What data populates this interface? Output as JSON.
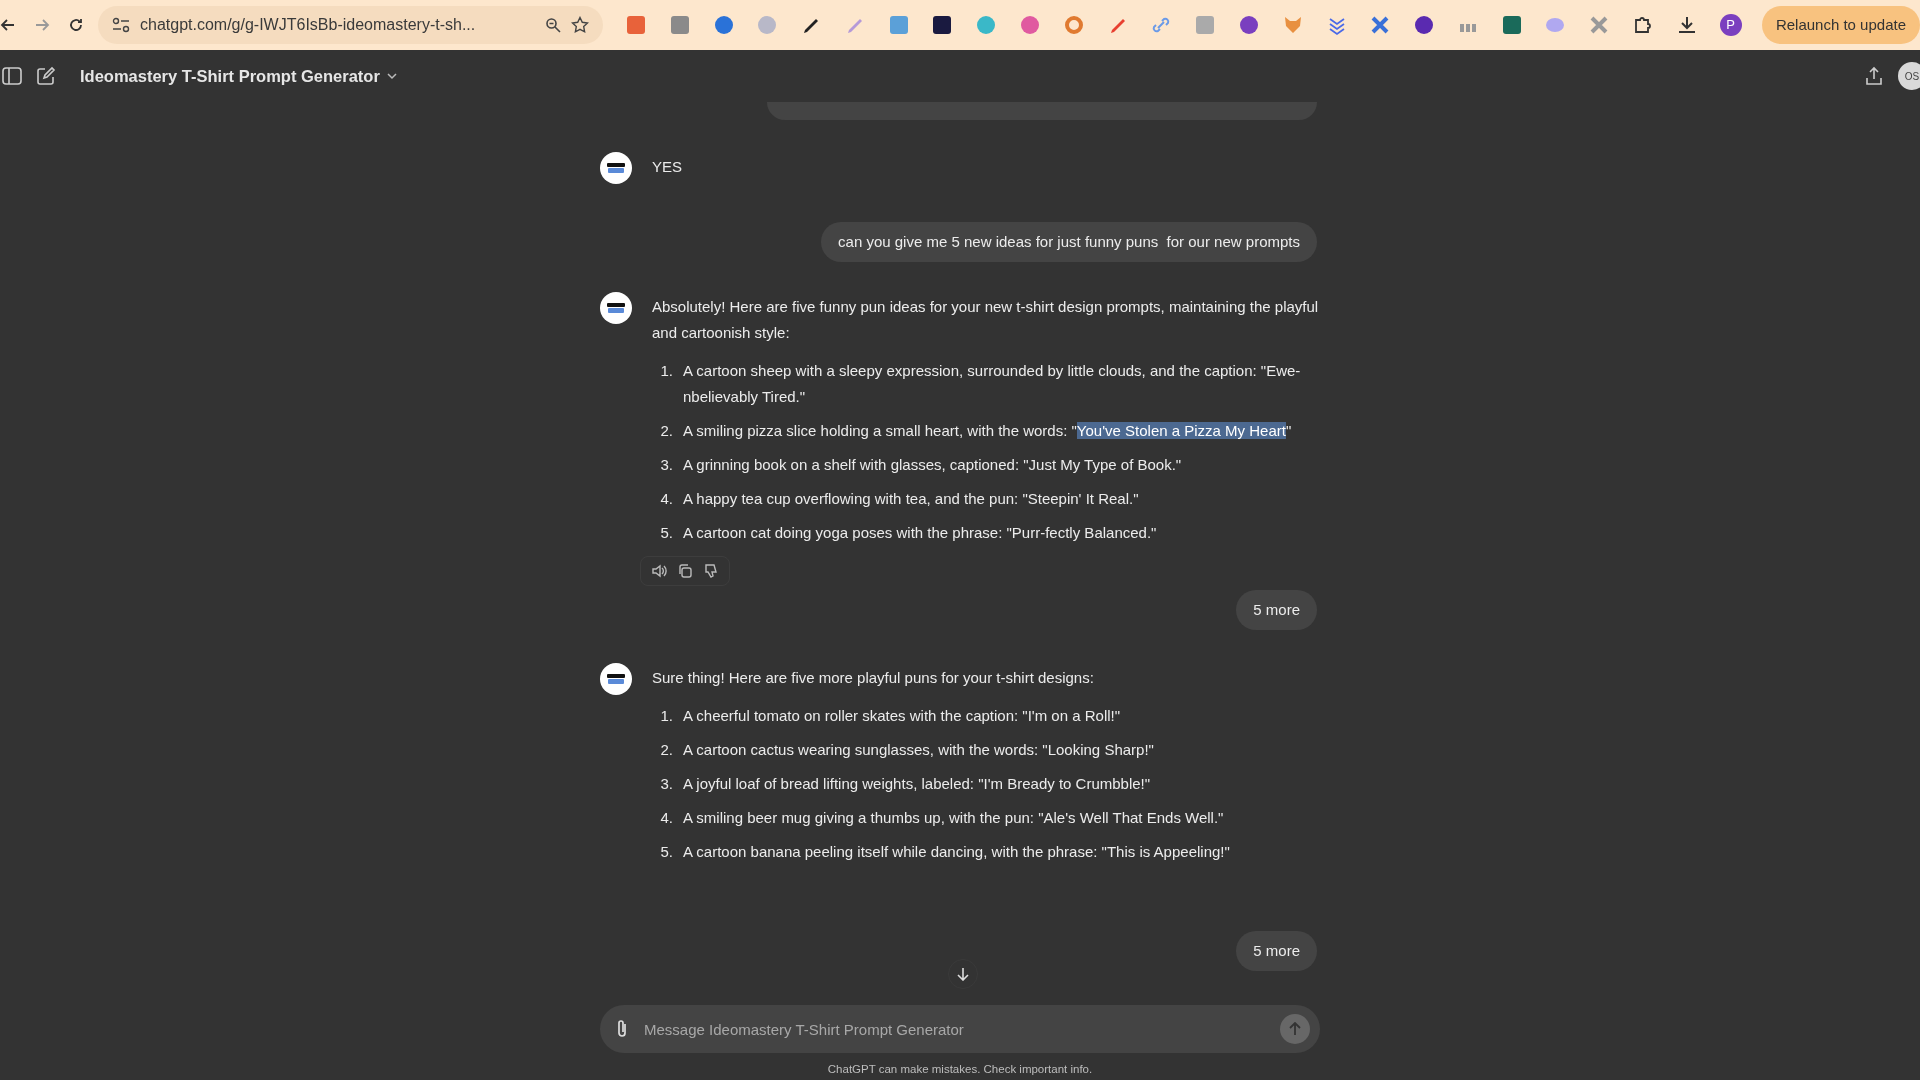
{
  "browser": {
    "url": "chatgpt.com/g/g-IWJT6IsBb-ideomastery-t-sh...",
    "profile_initial": "P",
    "relaunch_button": "Relaunch to update"
  },
  "header": {
    "title": "Ideomastery T-Shirt Prompt Generator",
    "user_initials": "OS"
  },
  "messages": [
    {
      "kind": "clipped"
    },
    {
      "kind": "assistant",
      "text": "YES",
      "show_actions": false
    },
    {
      "kind": "user",
      "text": "can you give me 5 new ideas for just funny puns  for our new prompts"
    },
    {
      "kind": "assistant",
      "text": "Absolutely! Here are five funny pun ideas for your new t-shirt design prompts, maintaining the playful and cartoonish style:",
      "show_actions": true,
      "items": [
        {
          "number": "1.",
          "text": "A cartoon sheep with a sleepy expression, surrounded by little clouds, and the caption: \"Ewe-nbelievably Tired.\""
        },
        {
          "number": "2.",
          "text": "A smiling pizza slice holding a small heart, with the words: \"",
          "selection": "You've Stolen a Pizza My Heart",
          "after": "\""
        },
        {
          "number": "3.",
          "text": "A grinning book on a shelf with glasses, captioned: \"Just My Type of Book.\""
        },
        {
          "number": "4.",
          "text": "A happy tea cup overflowing with tea, and the pun: \"Steepin' It Real.\""
        },
        {
          "number": "5.",
          "text": "A cartoon cat doing yoga poses with the phrase: \"Purr-fectly Balanced.\""
        }
      ]
    },
    {
      "kind": "user",
      "text": "5 more"
    },
    {
      "kind": "assistant",
      "text": "Sure thing! Here are five more playful puns for your t-shirt designs:",
      "show_actions": false,
      "items": [
        {
          "number": "1.",
          "text": "A cheerful tomato on roller skates with the caption: \"I'm on a Roll!\""
        },
        {
          "number": "2.",
          "text": "A cartoon cactus wearing sunglasses, with the words: \"Looking Sharp!\""
        },
        {
          "number": "3.",
          "text": "A joyful loaf of bread lifting weights, labeled: \"I'm Bready to Crumbble!\""
        },
        {
          "number": "4.",
          "text": "A smiling beer mug giving a thumbs up, with the pun: \"Ale's Well That Ends Well.\""
        },
        {
          "number": "5.",
          "text": "A cartoon banana peeling itself while dancing, with the phrase: \"This is Appeeling!\""
        }
      ]
    },
    {
      "kind": "user",
      "text": "5 more"
    }
  ],
  "composer": {
    "placeholder": "Message Ideomastery T-Shirt Prompt Generator"
  },
  "footer": "ChatGPT can make mistakes. Check important info."
}
